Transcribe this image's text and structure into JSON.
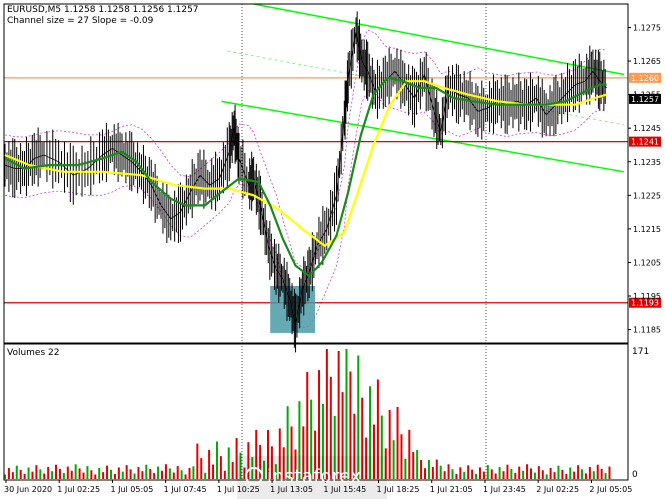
{
  "header": {
    "symbol_line": "EURUSD,M5  1.1258 1.1258 1.1256 1.1257",
    "channel_line": "Channel size = 27 Slope = -0.09"
  },
  "volume_panel": {
    "label": "Volumes 22",
    "axis_labels": [
      "171",
      "0"
    ]
  },
  "watermark": {
    "text": "instaforex"
  },
  "colors": {
    "price_line": "#000000",
    "ma_fast": "#1a8a1a",
    "ma_slow": "#ffff00",
    "channel": "#00ff00",
    "channel_mid": "#90ee90",
    "envelope": "#cc44cc",
    "level_red": "#e00000",
    "level_orange": "#ff9a50",
    "volume_bar": "#e00000",
    "volume_bar_up": "#00aa00",
    "highlight_box": "#4a9aa8"
  },
  "chart_data": {
    "type": "line",
    "title": "EURUSD,M5",
    "y_axis": {
      "ylim": [
        1.1181,
        1.1282
      ],
      "ticks": [
        "1.1275",
        "1.1265",
        "1.1255",
        "1.1245",
        "1.1235",
        "1.1225",
        "1.1215",
        "1.1205",
        "1.1195",
        "1.1185"
      ]
    },
    "x_axis": {
      "ticks": [
        "30 Jun 2020",
        "1 Jul 02:25",
        "1 Jul 05:05",
        "1 Jul 07:45",
        "1 Jul 10:25",
        "1 Jul 13:05",
        "1 Jul 15:45",
        "1 Jul 18:25",
        "1 Jul 21:05",
        "1 Jul 23:45",
        "2 Jul 02:25",
        "2 Jul 05:05"
      ]
    },
    "levels": [
      {
        "value": 1.126,
        "label": "1.1260",
        "color": "#ff9a50"
      },
      {
        "value": 1.1241,
        "label": "1.1241",
        "color": "#e00000"
      },
      {
        "value": 1.1193,
        "label": "1.1193",
        "color": "#e00000"
      }
    ],
    "last_price": {
      "value": 1.1257,
      "label": "1.1257"
    },
    "price_series": [
      [
        0,
        1.1234
      ],
      [
        10,
        1.1233
      ],
      [
        20,
        1.1233
      ],
      [
        30,
        1.1236
      ],
      [
        40,
        1.1237
      ],
      [
        55,
        1.1235
      ],
      [
        70,
        1.1231
      ],
      [
        85,
        1.1233
      ],
      [
        100,
        1.1237
      ],
      [
        110,
        1.1239
      ],
      [
        120,
        1.1237
      ],
      [
        130,
        1.1235
      ],
      [
        140,
        1.1232
      ],
      [
        150,
        1.1228
      ],
      [
        160,
        1.1222
      ],
      [
        170,
        1.1218
      ],
      [
        180,
        1.122
      ],
      [
        190,
        1.1226
      ],
      [
        200,
        1.1231
      ],
      [
        210,
        1.1228
      ],
      [
        220,
        1.123
      ],
      [
        230,
        1.1238
      ],
      [
        235,
        1.1245
      ],
      [
        240,
        1.1236
      ],
      [
        250,
        1.1228
      ],
      [
        255,
        1.123
      ],
      [
        262,
        1.1222
      ],
      [
        270,
        1.121
      ],
      [
        278,
        1.1203
      ],
      [
        285,
        1.12
      ],
      [
        292,
        1.1194
      ],
      [
        298,
        1.1187
      ],
      [
        305,
        1.1197
      ],
      [
        312,
        1.1202
      ],
      [
        320,
        1.121
      ],
      [
        330,
        1.1215
      ],
      [
        340,
        1.1225
      ],
      [
        348,
        1.1248
      ],
      [
        352,
        1.126
      ],
      [
        360,
        1.1274
      ],
      [
        366,
        1.1265
      ],
      [
        372,
        1.1262
      ],
      [
        380,
        1.1256
      ],
      [
        390,
        1.1259
      ],
      [
        400,
        1.1262
      ],
      [
        410,
        1.1258
      ],
      [
        420,
        1.1254
      ],
      [
        430,
        1.1261
      ],
      [
        440,
        1.125
      ],
      [
        447,
        1.1244
      ],
      [
        455,
        1.1257
      ],
      [
        465,
        1.1255
      ],
      [
        475,
        1.1254
      ],
      [
        485,
        1.125
      ],
      [
        495,
        1.1251
      ],
      [
        505,
        1.1253
      ],
      [
        515,
        1.1252
      ],
      [
        525,
        1.1253
      ],
      [
        535,
        1.1252
      ],
      [
        545,
        1.1254
      ],
      [
        555,
        1.1249
      ],
      [
        565,
        1.1252
      ],
      [
        575,
        1.1255
      ],
      [
        585,
        1.1258
      ],
      [
        595,
        1.1259
      ],
      [
        603,
        1.1262
      ],
      [
        610,
        1.1259
      ],
      [
        617,
        1.1257
      ]
    ],
    "ma_fast_series": [
      [
        0,
        1.1236
      ],
      [
        20,
        1.1233
      ],
      [
        45,
        1.1234
      ],
      [
        75,
        1.1234
      ],
      [
        100,
        1.1236
      ],
      [
        120,
        1.1238
      ],
      [
        135,
        1.1235
      ],
      [
        150,
        1.1229
      ],
      [
        170,
        1.1224
      ],
      [
        185,
        1.1222
      ],
      [
        205,
        1.1222
      ],
      [
        222,
        1.1226
      ],
      [
        240,
        1.123
      ],
      [
        260,
        1.1229
      ],
      [
        272,
        1.1222
      ],
      [
        285,
        1.1212
      ],
      [
        298,
        1.1204
      ],
      [
        312,
        1.1201
      ],
      [
        325,
        1.1205
      ],
      [
        340,
        1.1213
      ],
      [
        352,
        1.1226
      ],
      [
        365,
        1.1243
      ],
      [
        378,
        1.1255
      ],
      [
        392,
        1.126
      ],
      [
        408,
        1.1259
      ],
      [
        425,
        1.1257
      ],
      [
        442,
        1.1257
      ],
      [
        460,
        1.1254
      ],
      [
        480,
        1.1253
      ],
      [
        505,
        1.1252
      ],
      [
        530,
        1.1252
      ],
      [
        555,
        1.1252
      ],
      [
        575,
        1.1253
      ],
      [
        595,
        1.1256
      ],
      [
        610,
        1.1258
      ],
      [
        617,
        1.1258
      ]
    ],
    "ma_slow_series": [
      [
        0,
        1.1237
      ],
      [
        25,
        1.1234
      ],
      [
        60,
        1.1232
      ],
      [
        100,
        1.1232
      ],
      [
        140,
        1.1231
      ],
      [
        175,
        1.1228
      ],
      [
        205,
        1.1227
      ],
      [
        230,
        1.1227
      ],
      [
        255,
        1.1225
      ],
      [
        280,
        1.1221
      ],
      [
        305,
        1.1215
      ],
      [
        328,
        1.121
      ],
      [
        348,
        1.1214
      ],
      [
        362,
        1.1226
      ],
      [
        378,
        1.124
      ],
      [
        395,
        1.1252
      ],
      [
        412,
        1.1259
      ],
      [
        430,
        1.1259
      ],
      [
        450,
        1.1257
      ],
      [
        475,
        1.1255
      ],
      [
        505,
        1.1253
      ],
      [
        535,
        1.1252
      ],
      [
        560,
        1.1252
      ],
      [
        585,
        1.1252
      ],
      [
        605,
        1.1254
      ],
      [
        617,
        1.1255
      ]
    ],
    "channel": {
      "upper": [
        [
          255,
          1.1282
        ],
        [
          635,
          1.1261
        ]
      ],
      "middle": [
        [
          228,
          1.1268
        ],
        [
          635,
          1.1246
        ]
      ],
      "lower": [
        [
          222,
          1.1253
        ],
        [
          635,
          1.1232
        ]
      ]
    },
    "volume": {
      "ylim": [
        0,
        171
      ],
      "x_start": 0,
      "x_end": 620
    }
  }
}
